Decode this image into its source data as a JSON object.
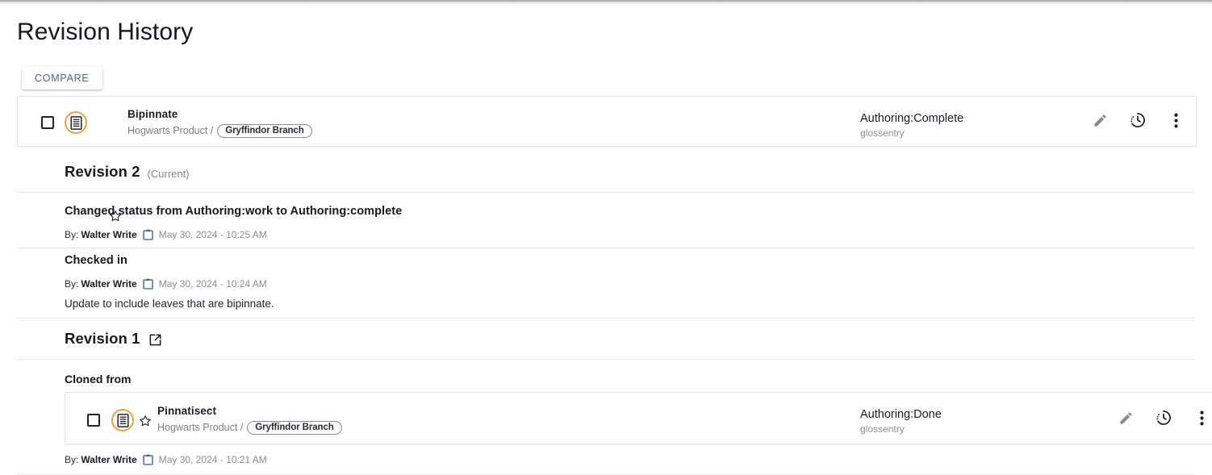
{
  "page": {
    "title": "Revision History"
  },
  "toolbar": {
    "compare_label": "COMPARE"
  },
  "documents": {
    "primary": {
      "name": "Bipinnate",
      "product": "Hogwarts Product /",
      "branch": "Gryffindor Branch",
      "status": "Authoring:Complete",
      "doctype": "glossentry",
      "icons": {
        "checkbox": "checkbox-unchecked-icon",
        "doc": "document-type-icon",
        "star": "star-outline-icon",
        "edit": "pencil-edit-icon",
        "history": "clock-history-icon",
        "more": "more-vertical-icon"
      }
    },
    "cloned": {
      "name": "Pinnatisect",
      "product": "Hogwarts Product /",
      "branch": "Gryffindor Branch",
      "status": "Authoring:Done",
      "doctype": "glossentry",
      "icons": {
        "checkbox": "checkbox-unchecked-icon",
        "doc": "document-type-icon",
        "star": "star-outline-icon",
        "edit": "pencil-edit-icon",
        "history": "clock-history-icon",
        "more": "more-vertical-icon"
      }
    }
  },
  "revisions": [
    {
      "label": "Revision 2",
      "current_tag": "(Current)",
      "entries": [
        {
          "title": "Changed status from Authoring:work to Authoring:complete",
          "by_prefix": "By:",
          "by_name": "Walter Write",
          "date": "May 30, 2024 - 10:25 AM",
          "body": ""
        },
        {
          "title": "Checked in",
          "by_prefix": "By:",
          "by_name": "Walter Write",
          "date": "May 30, 2024 - 10:24 AM",
          "body": "Update to include leaves that are bipinnate."
        }
      ]
    },
    {
      "label": "Revision 1",
      "open_icon": "external-link-icon",
      "cloned_from_label": "Cloned from",
      "byline": {
        "by_prefix": "By:",
        "by_name": "Walter Write",
        "date": "May 30, 2024 - 10:21 AM"
      }
    }
  ],
  "colors": {
    "accent_orange": "#f2a03d",
    "link_blue": "#4a6491",
    "calendar_blue": "#3b6fb5",
    "text_dark": "#18181f",
    "text_muted": "#8b8b96"
  }
}
